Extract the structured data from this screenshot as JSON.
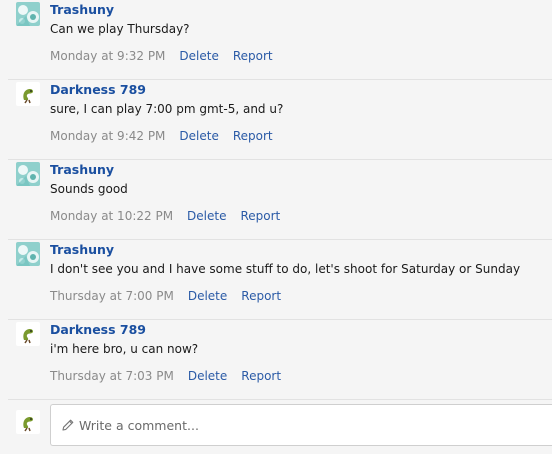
{
  "comments": [
    {
      "author": "Trashuny",
      "avatar": "teal-flower-avatar-icon",
      "text": "Can we play Thursday?",
      "time": "Monday at 9:32 PM",
      "delete_label": "Delete",
      "report_label": "Report"
    },
    {
      "author": "Darkness 789",
      "avatar": "green-dino-avatar-icon",
      "text": "sure, I can play 7:00 pm gmt-5, and u?",
      "time": "Monday at 9:42 PM",
      "delete_label": "Delete",
      "report_label": "Report"
    },
    {
      "author": "Trashuny",
      "avatar": "teal-flower-avatar-icon",
      "text": "Sounds good",
      "time": "Monday at 10:22 PM",
      "delete_label": "Delete",
      "report_label": "Report"
    },
    {
      "author": "Trashuny",
      "avatar": "teal-flower-avatar-icon",
      "text": "I don't see you and I have some stuff to do, let's shoot for Saturday or Sunday",
      "time": "Thursday at 7:00 PM",
      "delete_label": "Delete",
      "report_label": "Report"
    },
    {
      "author": "Darkness 789",
      "avatar": "green-dino-avatar-icon",
      "text": "i'm here bro, u can now?",
      "time": "Thursday at 7:03 PM",
      "delete_label": "Delete",
      "report_label": "Report"
    }
  ],
  "composer": {
    "avatar": "green-dino-avatar-icon",
    "icon": "pencil-icon",
    "placeholder": "Write a comment..."
  },
  "colors": {
    "background": "#f5f5f5",
    "author_link": "#1a4fa0",
    "action_link": "#2a5aa6",
    "timestamp": "#8a8a8a",
    "divider": "#e2e2e2"
  }
}
